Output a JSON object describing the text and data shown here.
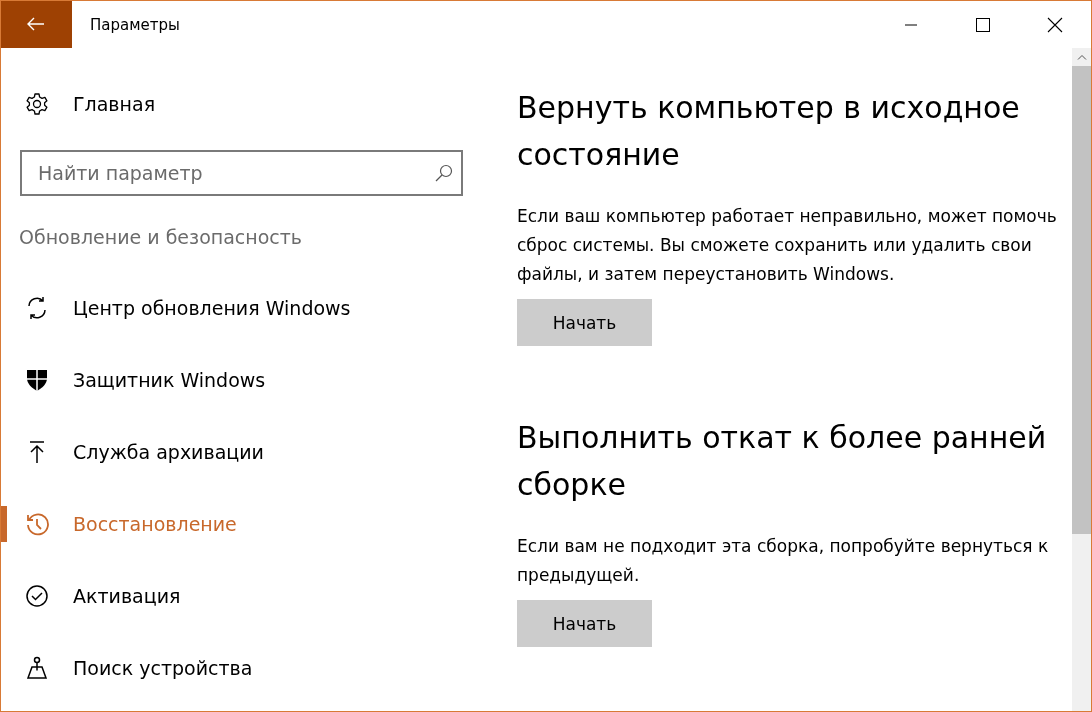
{
  "window": {
    "title": "Параметры"
  },
  "sidebar": {
    "home": "Главная",
    "search": {
      "placeholder": "Найти параметр"
    },
    "section": "Обновление и безопасность",
    "items": [
      {
        "label": "Центр обновления Windows",
        "selected": false
      },
      {
        "label": "Защитник Windows",
        "selected": false
      },
      {
        "label": "Служба архивации",
        "selected": false
      },
      {
        "label": "Восстановление",
        "selected": true
      },
      {
        "label": "Активация",
        "selected": false
      },
      {
        "label": "Поиск устройства",
        "selected": false
      }
    ]
  },
  "sections": [
    {
      "title": "Вернуть компьютер в исходное состояние",
      "text": "Если ваш компьютер работает неправильно, может помочь сброс системы. Вы сможете сохранить или удалить свои файлы, и затем переустановить Windows.",
      "button": "Начать"
    },
    {
      "title": "Выполнить откат к более ранней сборке",
      "text": "Если вам не подходит эта сборка, попробуйте вернуться к предыдущей.",
      "button": "Начать"
    }
  ]
}
